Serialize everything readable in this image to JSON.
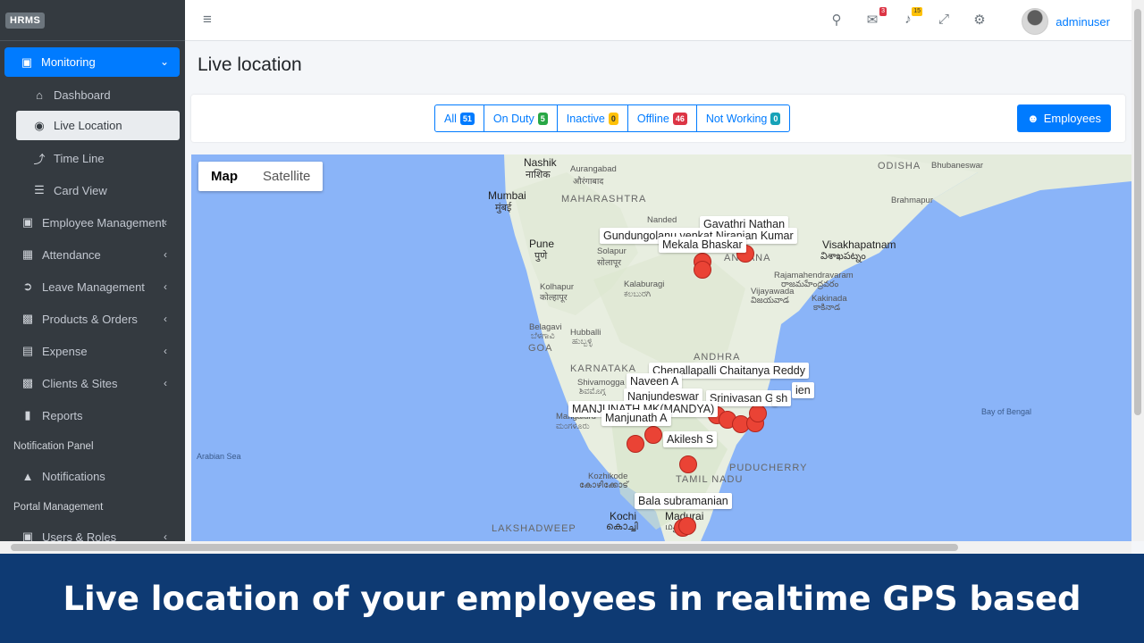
{
  "brand": "HRMS",
  "sidebar": {
    "items": [
      {
        "label": "Monitoring"
      },
      {
        "label": "Dashboard"
      },
      {
        "label": "Live Location"
      },
      {
        "label": "Time Line"
      },
      {
        "label": "Card View"
      },
      {
        "label": "Employee Management"
      },
      {
        "label": "Attendance"
      },
      {
        "label": "Leave Management"
      },
      {
        "label": "Products & Orders"
      },
      {
        "label": "Expense"
      },
      {
        "label": "Clients & Sites"
      },
      {
        "label": "Reports"
      },
      {
        "label": "Notifications"
      },
      {
        "label": "Users & Roles"
      }
    ],
    "headers": [
      "Notification Panel",
      "Portal Management"
    ]
  },
  "topbar": {
    "messages_count": "3",
    "notifications_count": "15",
    "username": "adminuser"
  },
  "page_title": "Live location",
  "filters": [
    {
      "label": "All",
      "count": "51",
      "color": "#007bff"
    },
    {
      "label": "On Duty",
      "count": "5",
      "color": "#28a745"
    },
    {
      "label": "Inactive",
      "count": "0",
      "color": "#ffc107"
    },
    {
      "label": "Offline",
      "count": "46",
      "color": "#dc3545"
    },
    {
      "label": "Not Working",
      "count": "0",
      "color": "#17a2b8"
    }
  ],
  "employees_button": "Employees",
  "map": {
    "toggle": [
      "Map",
      "Satellite"
    ],
    "places": [
      "Nashik",
      "नाशिक",
      "Aurangabad",
      "औरंगाबाद",
      "MAHARASHTRA",
      "Mumbai",
      "मुंबई",
      "Nanded",
      "Pune",
      "पुणे",
      "Solapur",
      "सोलापूर",
      "Kolhapur",
      "कोल्हापूर",
      "Kalaburagi",
      "ಕಲಬುರಗಿ",
      "Belagavi",
      "ಬೆಳಗಾವಿ",
      "Hubballi",
      "ಹುಬ್ಬಳ್ಳಿ",
      "GOA",
      "ANDHRA",
      "KARNATAKA",
      "Shivamogga",
      "ಶಿವಮೊಗ್ಗ",
      "Mangaluru",
      "ಮಂಗಳೂರು",
      "Kozhikode",
      "കോഴിക്കോട്",
      "TAMIL NADU",
      "PUDUCHERRY",
      "Kochi",
      "കൊച്ചി",
      "Madurai",
      "மதுரை",
      "LAKSHADWEEP",
      "Visakhapatnam",
      "విశాఖపట్నం",
      "Rajamahendravaram",
      "రాజమహేంద్రవరం",
      "Vijayawada",
      "విజయవాడ",
      "Kakinada",
      "కాకినాడ",
      "ODISHA",
      "Bhubaneswar",
      "Brahmapur",
      "Bay of Bengal",
      "Arabian Sea",
      "ANGANA"
    ],
    "employees": [
      "Gayathri Nathan",
      "Gundungolanu venkat Niranjan Kumar",
      "Mekala Bhaskar",
      "Chenallapalli Chaitanya Reddy",
      "Naveen A",
      "Nanjundeswar",
      "Srinivasan G",
      "sh",
      "ien",
      "MANJUNATH MK(MANDYA)",
      "Manjunath A",
      "Akilesh S",
      "Bala subramanian"
    ]
  },
  "banner": "Live location of your employees in realtime GPS based"
}
